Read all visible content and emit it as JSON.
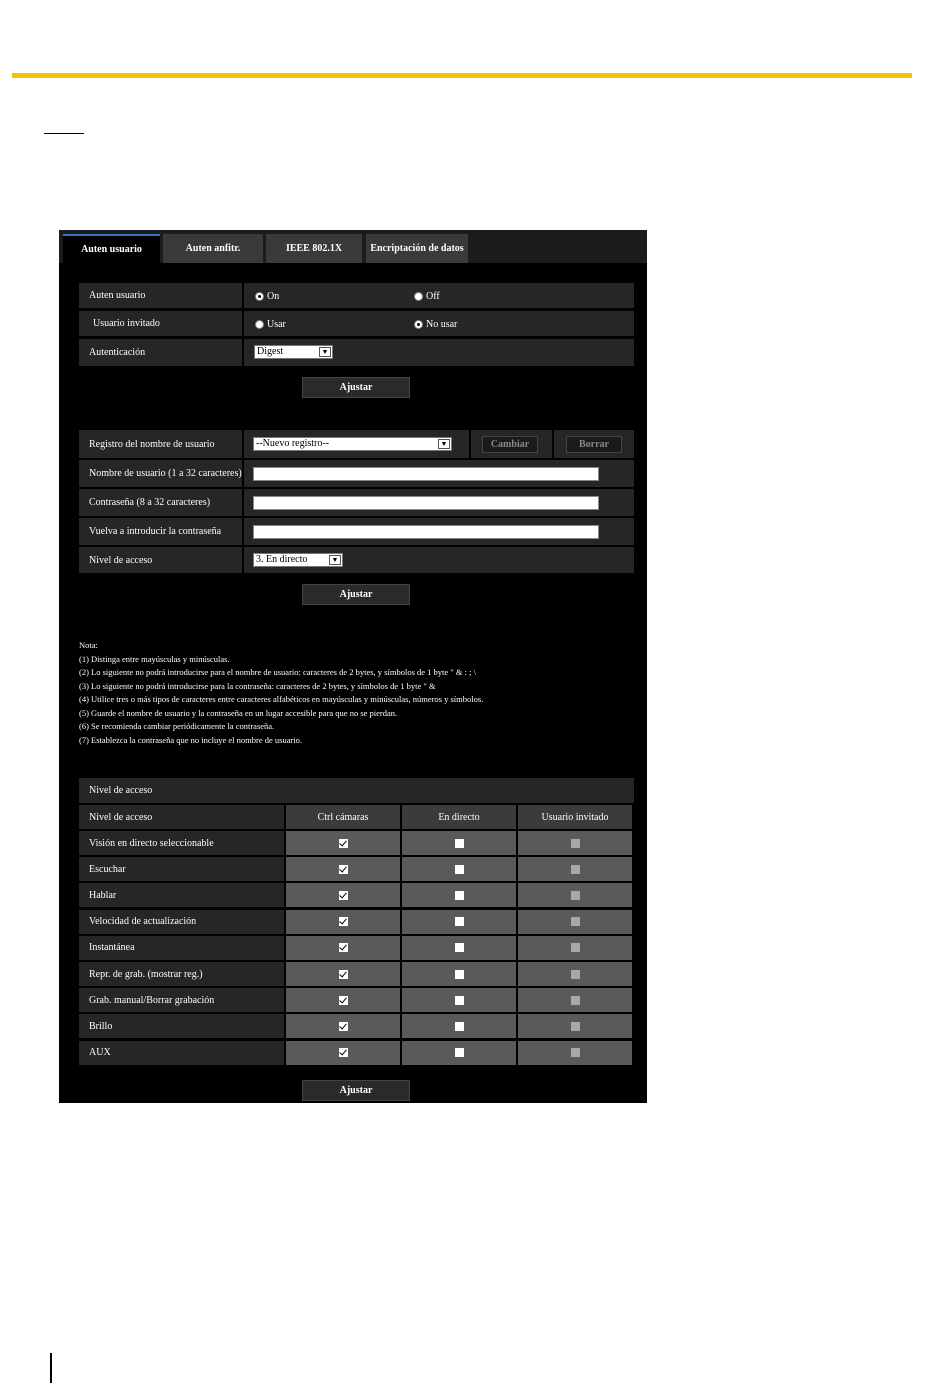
{
  "tabs": [
    {
      "label": "Auten usuario",
      "active": true
    },
    {
      "label": "Auten anfitr.",
      "active": false
    },
    {
      "label": "IEEE 802.1X",
      "active": false
    },
    {
      "label": "Encriptación de datos",
      "active": false
    }
  ],
  "auth_section": {
    "user_auth": {
      "label": "Auten usuario",
      "opt_on": "On",
      "opt_off": "Off",
      "selected": "On"
    },
    "guest_user": {
      "label": "Usuario invitado",
      "opt_use": "Usar",
      "opt_nouse": "No usar",
      "selected": "No usar"
    },
    "authentication": {
      "label": "Autenticación",
      "value": "Digest"
    },
    "set_button": "Ajustar"
  },
  "user_section": {
    "registry": {
      "label": "Registro del nombre de usuario",
      "value": "--Nuevo registro--",
      "change_button": "Cambiar",
      "delete_button": "Borrar"
    },
    "username": {
      "label": "Nombre de usuario (1 a 32 caracteres)",
      "value": ""
    },
    "password": {
      "label": "Contraseña (8 a 32 caracteres)",
      "value": ""
    },
    "password_confirm": {
      "label": "Vuelva a introducir la contraseña",
      "value": ""
    },
    "access_level": {
      "label": "Nivel de acceso",
      "value": "3. En directo"
    },
    "set_button": "Ajustar"
  },
  "notes": [
    "Nota:",
    "(1) Distinga entre mayúsculas y minúsculas.",
    "(2) Lo siguiente no podrá introducirse para el nombre de usuario:   caracteres de 2 bytes, y símbolos de 1 byte \" & : ; \\",
    "(3) Lo siguiente no podrá introducirse para la contraseña:   caracteres de 2 bytes, y símbolos de 1 byte \" &",
    "(4) Utilice tres o más tipos de caracteres entre caracteres alfabéticos en mayúsculas y minúsculas, números y símbolos.",
    "(5) Guarde el nombre de usuario y la contraseña en un lugar accesible para que no se pierdan.",
    "(6) Se recomienda cambiar periódicamente la contraseña.",
    "(7) Establezca la contraseña que no incluye el nombre de usuario."
  ],
  "access_matrix": {
    "title": "Nivel de acceso",
    "header_label": "Nivel de acceso",
    "columns": [
      "Ctrl cámaras",
      "En directo",
      "Usuario invitado"
    ],
    "rows": [
      {
        "label": "Visión en directo seleccionable",
        "values": [
          true,
          false,
          false
        ]
      },
      {
        "label": "Escuchar",
        "values": [
          true,
          false,
          false
        ]
      },
      {
        "label": "Hablar",
        "values": [
          true,
          false,
          false
        ]
      },
      {
        "label": "Velocidad de actualización",
        "values": [
          true,
          false,
          false
        ]
      },
      {
        "label": "Instantánea",
        "values": [
          true,
          false,
          false
        ]
      },
      {
        "label": "Repr. de grab. (mostrar reg.)",
        "values": [
          true,
          false,
          false
        ]
      },
      {
        "label": "Grab. manual/Borrar grabación",
        "values": [
          true,
          false,
          false
        ]
      },
      {
        "label": "Brillo",
        "values": [
          true,
          false,
          false
        ]
      },
      {
        "label": "AUX",
        "values": [
          true,
          false,
          false
        ]
      }
    ],
    "set_button": "Ajustar"
  },
  "colors": {
    "accent_rule": "#f2c500",
    "active_tab_border": "#3a77c8",
    "panel_bg": "#000000"
  }
}
